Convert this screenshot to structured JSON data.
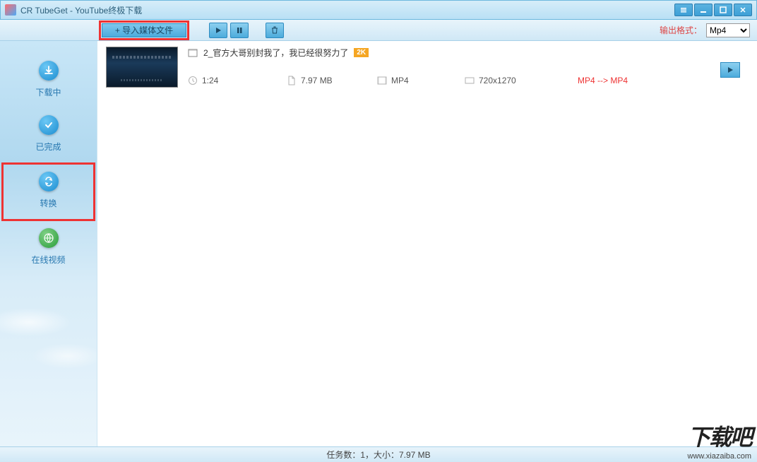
{
  "window": {
    "title": "CR TubeGet - YouTube终极下载"
  },
  "toolbar": {
    "import_label": "+ 导入媒体文件",
    "output_label": "输出格式：",
    "format_options": [
      "Mp4"
    ],
    "format_selected": "Mp4"
  },
  "sidebar": {
    "items": [
      {
        "label": "下载中"
      },
      {
        "label": "已完成"
      },
      {
        "label": "转换"
      },
      {
        "label": "在线视频"
      }
    ]
  },
  "video_item": {
    "title": "2_官方大哥别封我了，我已经很努力了",
    "quality": "2K",
    "duration": "1:24",
    "filesize": "7.97 MB",
    "format": "MP4",
    "resolution": "720x1270",
    "conversion": "MP4 --> MP4"
  },
  "statusbar": {
    "text": "任务数：1，大小：7.97 MB"
  },
  "watermark": {
    "logo": "下载吧",
    "url": "www.xiazaiba.com"
  }
}
